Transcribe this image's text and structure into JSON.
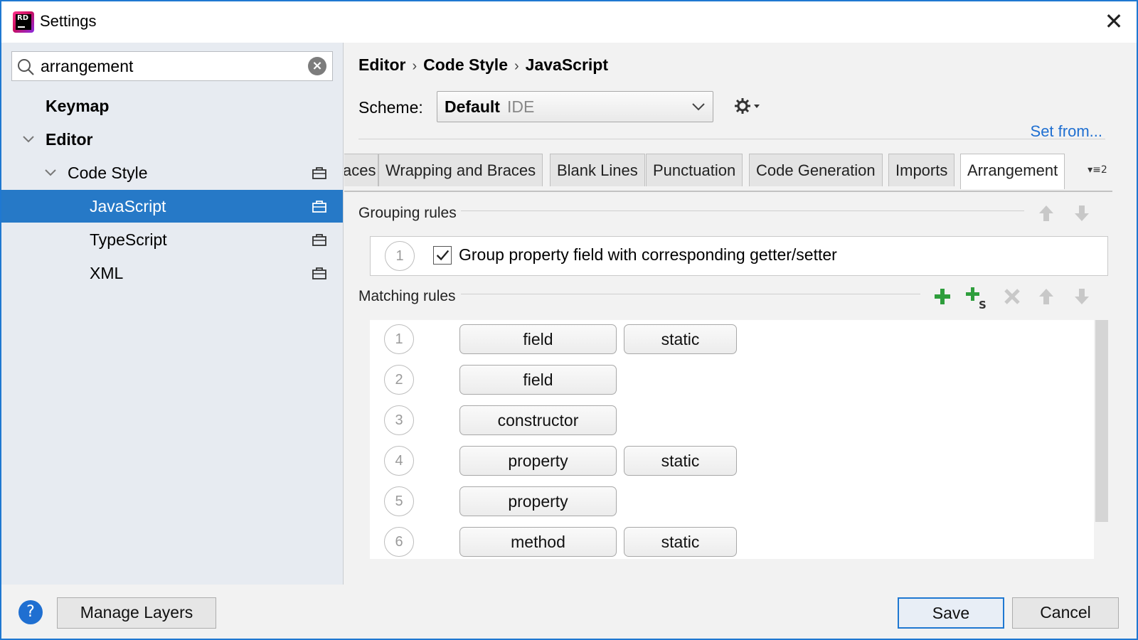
{
  "window": {
    "title": "Settings",
    "logo_text": "RD"
  },
  "search": {
    "value": "arrangement"
  },
  "tree": {
    "keymap": "Keymap",
    "editor": "Editor",
    "code_style": "Code Style",
    "javascript": "JavaScript",
    "typescript": "TypeScript",
    "xml": "XML"
  },
  "breadcrumb": {
    "part1": "Editor",
    "part2": "Code Style",
    "part3": "JavaScript",
    "separator": "›"
  },
  "scheme": {
    "label": "Scheme:",
    "name": "Default",
    "tag": "IDE"
  },
  "set_from": "Set from...",
  "tabs": {
    "partial": "aces",
    "wrapping": "Wrapping and Braces",
    "blank_lines": "Blank Lines",
    "punctuation": "Punctuation",
    "code_generation": "Code Generation",
    "imports": "Imports",
    "arrangement": "Arrangement",
    "overflow": "▾≡2"
  },
  "grouping": {
    "title": "Grouping rules",
    "rule_number": "1",
    "rule_label": "Group property field with corresponding getter/setter",
    "checked": true
  },
  "matching": {
    "title": "Matching rules",
    "rules": [
      {
        "num": "1",
        "p1": "field",
        "p2": "static"
      },
      {
        "num": "2",
        "p1": "field",
        "p2": ""
      },
      {
        "num": "3",
        "p1": "constructor",
        "p2": ""
      },
      {
        "num": "4",
        "p1": "property",
        "p2": "static"
      },
      {
        "num": "5",
        "p1": "property",
        "p2": ""
      },
      {
        "num": "6",
        "p1": "method",
        "p2": "static"
      }
    ]
  },
  "buttons": {
    "help": "?",
    "manage_layers": "Manage Layers",
    "save": "Save",
    "cancel": "Cancel"
  },
  "colors": {
    "selection": "#2679c7",
    "accent": "#1f78d1",
    "link": "#1f6fd1",
    "add_green": "#2e9e3c"
  }
}
